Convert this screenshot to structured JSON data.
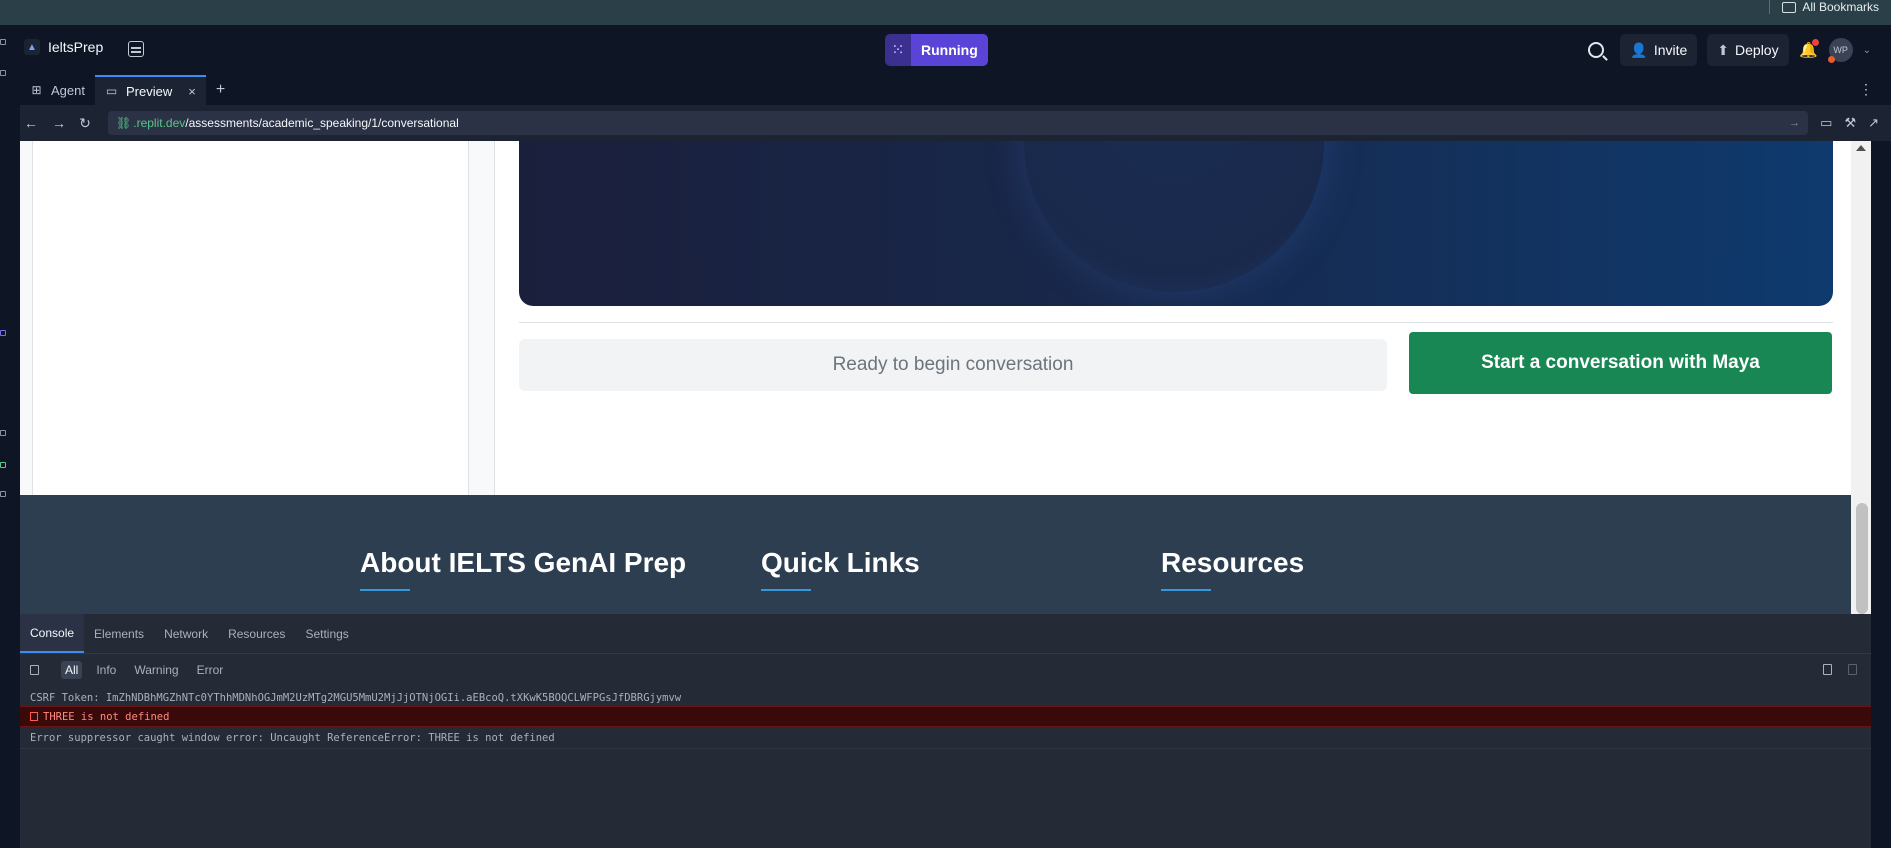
{
  "bookmarks": {
    "all_label": "All Bookmarks"
  },
  "topbar": {
    "app_name": "IeltsPrep",
    "run_status": "Running",
    "invite_label": "Invite",
    "deploy_label": "Deploy",
    "avatar_initials": "WP"
  },
  "tabs": [
    {
      "label": "Agent"
    },
    {
      "label": "Preview",
      "close": "×"
    }
  ],
  "tabs_add": "+",
  "address": {
    "host": ".replit.dev",
    "path": "/assessments/academic_speaking/1/conversational"
  },
  "page": {
    "status_text": "Ready to begin conversation",
    "start_button": "Start a conversation with Maya",
    "footer": {
      "about": "About IELTS GenAI Prep",
      "quick_links": "Quick Links",
      "resources": "Resources"
    }
  },
  "devtools": {
    "tabs": [
      "Console",
      "Elements",
      "Network",
      "Resources",
      "Settings"
    ],
    "filters": [
      "All",
      "Info",
      "Warning",
      "Error"
    ],
    "logs": [
      {
        "level": "log",
        "text": "CSRF Token: ImZhNDBhMGZhNTc0YThhMDNhOGJmM2UzMTg2MGU5MmU2MjJjOTNjOGIi.aEBcoQ.tXKwK5BOQCLWFPGsJfDBRGjymvw"
      },
      {
        "level": "error",
        "text": "THREE is not defined"
      },
      {
        "level": "log",
        "text": "Error suppressor caught window error: Uncaught ReferenceError: THREE is not defined"
      }
    ]
  },
  "colors": {
    "accent": "#5a44d8",
    "start_button": "#198754",
    "footer_bg": "#2c3e50",
    "url_host": "#58c788"
  }
}
